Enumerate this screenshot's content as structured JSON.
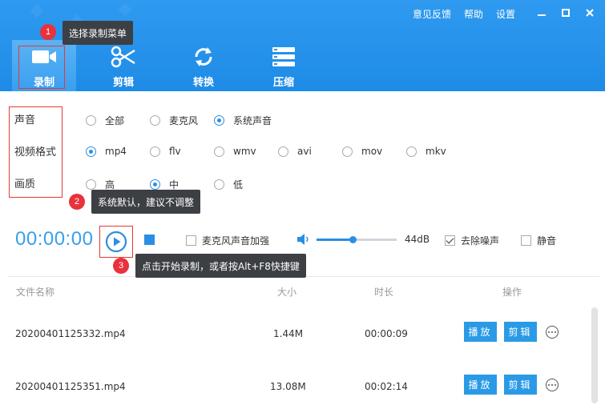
{
  "header": {
    "top_links": [
      "意见反馈",
      "帮助",
      "设置"
    ],
    "window_controls": [
      "minimize-icon",
      "maximize-icon",
      "close-icon"
    ],
    "nav": [
      {
        "label": "录制",
        "icon": "camera-icon",
        "active": true
      },
      {
        "label": "剪辑",
        "icon": "scissors-icon",
        "active": false
      },
      {
        "label": "转换",
        "icon": "convert-icon",
        "active": false
      },
      {
        "label": "压缩",
        "icon": "compress-icon",
        "active": false
      }
    ]
  },
  "tips": [
    {
      "num": "1",
      "text": "选择录制菜单"
    },
    {
      "num": "2",
      "text": "系统默认，建议不调整"
    },
    {
      "num": "3",
      "text": "点击开始录制，或者按Alt+F8快捷键"
    }
  ],
  "settings": {
    "audio": {
      "label": "声音",
      "options": [
        "全部",
        "麦克风",
        "系统声音"
      ],
      "selected": "系统声音"
    },
    "format": {
      "label": "视频格式",
      "options": [
        "mp4",
        "flv",
        "wmv",
        "avi",
        "mov",
        "mkv"
      ],
      "selected": "mp4"
    },
    "quality": {
      "label": "画质",
      "options": [
        "高",
        "中",
        "低"
      ],
      "selected": "中"
    }
  },
  "controls": {
    "timer": "00:00:00",
    "mic_boost": {
      "label": "麦克风声音加强",
      "checked": false
    },
    "volume": {
      "value": "44dB",
      "level": 0.45
    },
    "denoise": {
      "label": "去除噪声",
      "checked": true
    },
    "mute": {
      "label": "静音",
      "checked": false
    }
  },
  "table": {
    "columns": [
      "文件名称",
      "大小",
      "时长",
      "操作"
    ],
    "rows": [
      {
        "name": "20200401125332.mp4",
        "size": "1.44M",
        "duration": "00:00:09"
      },
      {
        "name": "20200401125351.mp4",
        "size": "13.08M",
        "duration": "00:02:14"
      }
    ],
    "actions": {
      "play": "播放",
      "edit": "剪辑"
    }
  },
  "colors": {
    "header": "#1e8be6",
    "accent": "#2a8ee3",
    "highlight": "#e53935"
  }
}
